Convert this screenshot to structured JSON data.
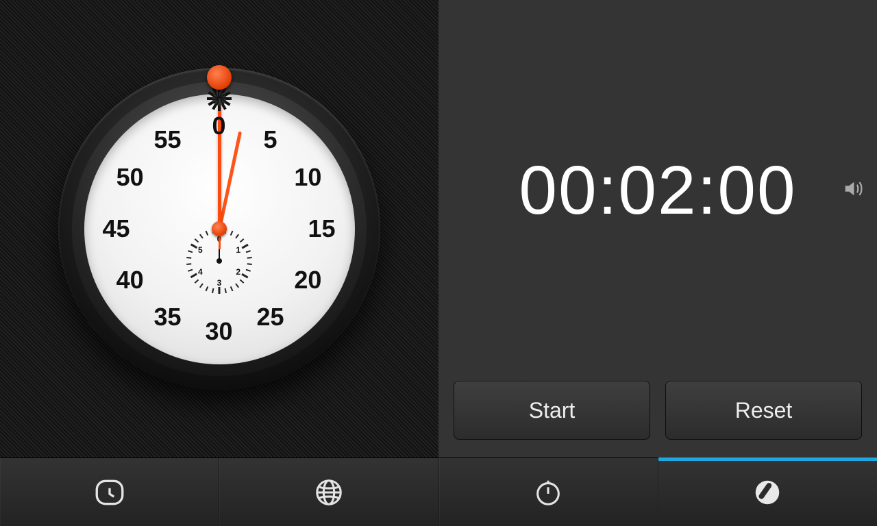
{
  "timer": {
    "display": "00:02:00",
    "start_label": "Start",
    "reset_label": "Reset",
    "sound_on": true
  },
  "dial": {
    "outer_numbers": [
      "0",
      "5",
      "10",
      "15",
      "20",
      "25",
      "30",
      "35",
      "40",
      "45",
      "50",
      "55"
    ],
    "inner_numbers": [
      "0",
      "1",
      "2",
      "3",
      "4",
      "5"
    ],
    "second_hand_angle_deg": 0,
    "minute_hand_angle_deg": 12,
    "sub_hand_angle_deg": 0
  },
  "tabs": {
    "items": [
      {
        "name": "alarm",
        "active": false
      },
      {
        "name": "worldclock",
        "active": false
      },
      {
        "name": "stopwatch",
        "active": false
      },
      {
        "name": "timer",
        "active": true
      }
    ]
  },
  "colors": {
    "accent": "#ff4a0d",
    "active_tab": "#1ea7e1"
  }
}
